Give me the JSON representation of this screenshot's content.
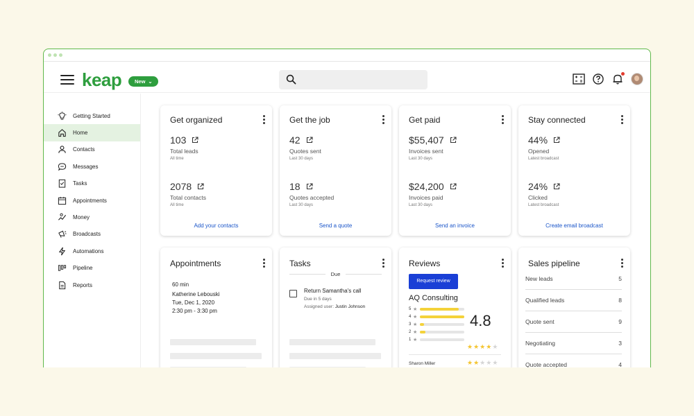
{
  "app": {
    "logo": "keap",
    "new_badge": "New"
  },
  "sidebar": {
    "items": [
      {
        "label": "Getting Started",
        "icon": "lightbulb-icon"
      },
      {
        "label": "Home",
        "icon": "home-icon",
        "active": true
      },
      {
        "label": "Contacts",
        "icon": "person-icon"
      },
      {
        "label": "Messages",
        "icon": "chat-icon"
      },
      {
        "label": "Tasks",
        "icon": "checklist-icon"
      },
      {
        "label": "Appointments",
        "icon": "calendar-icon"
      },
      {
        "label": "Money",
        "icon": "money-icon"
      },
      {
        "label": "Broadcasts",
        "icon": "megaphone-icon"
      },
      {
        "label": "Automations",
        "icon": "bolt-icon"
      },
      {
        "label": "Pipeline",
        "icon": "pipeline-icon"
      },
      {
        "label": "Reports",
        "icon": "report-icon"
      }
    ]
  },
  "cards": {
    "organized": {
      "title": "Get organized",
      "m1": {
        "value": "103",
        "label": "Total leads",
        "sub": "All time"
      },
      "m2": {
        "value": "2078",
        "label": "Total contacts",
        "sub": "All time"
      },
      "link": "Add your contacts"
    },
    "job": {
      "title": "Get the job",
      "m1": {
        "value": "42",
        "label": "Quotes sent",
        "sub": "Last 30 days"
      },
      "m2": {
        "value": "18",
        "label": "Quotes accepted",
        "sub": "Last 30 days"
      },
      "link": "Send a quote"
    },
    "paid": {
      "title": "Get paid",
      "m1": {
        "value": "$55,407",
        "label": "Invoices sent",
        "sub": "Last 30 days"
      },
      "m2": {
        "value": "$24,200",
        "label": "Invoices paid",
        "sub": "Last 30 days"
      },
      "link": "Send an invoice"
    },
    "connected": {
      "title": "Stay connected",
      "m1": {
        "value": "44%",
        "label": "Opened",
        "sub": "Latest broadcast"
      },
      "m2": {
        "value": "24%",
        "label": "Clicked",
        "sub": "Latest broadcast"
      },
      "link": "Create email broadcast"
    },
    "appointments": {
      "title": "Appointments",
      "duration": "60 min",
      "name": "Katherine Lebouski",
      "date": "Tue, Dec 1, 2020",
      "time": "2:30 pm - 3:30 pm"
    },
    "tasks": {
      "title": "Tasks",
      "section": "Due",
      "task_title": "Return Samantha's call",
      "task_due": "Due in 5 days",
      "assigned_label": "Assigned user:",
      "assigned_user": "Justin Johnson"
    },
    "reviews": {
      "title": "Reviews",
      "button": "Request review",
      "business": "AQ Consulting",
      "rating": "4.8",
      "rating_stars": 4,
      "distribution": [
        {
          "stars": "5",
          "fraction": 0.88
        },
        {
          "stars": "4",
          "fraction": 1.0
        },
        {
          "stars": "3",
          "fraction": 0.1
        },
        {
          "stars": "2",
          "fraction": 0.12
        },
        {
          "stars": "1",
          "fraction": 0.0
        }
      ],
      "reviewer": "Sharon Miller",
      "reviewer_stars": 2
    },
    "pipeline": {
      "title": "Sales pipeline",
      "rows": [
        {
          "label": "New leads",
          "count": "5"
        },
        {
          "label": "Qualified leads",
          "count": "8"
        },
        {
          "label": "Quote sent",
          "count": "9"
        },
        {
          "label": "Negotiating",
          "count": "3"
        },
        {
          "label": "Quote accepted",
          "count": "4"
        }
      ]
    }
  },
  "colors": {
    "brand": "#2e9e3e",
    "link": "#1a55c9",
    "button": "#1a3fd6",
    "star": "#f4c530",
    "frame": "#5fb84a"
  }
}
